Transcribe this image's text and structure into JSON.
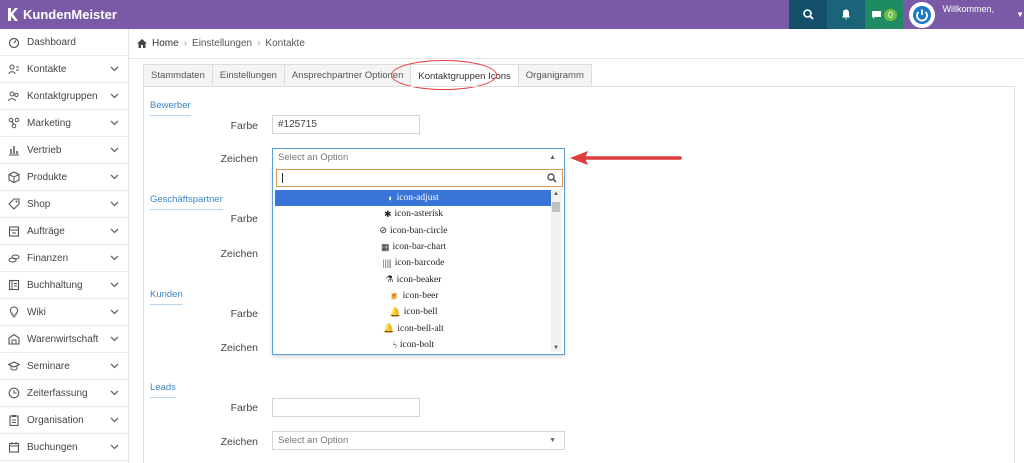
{
  "app": {
    "title": "KundenMeister"
  },
  "header": {
    "welcome": "Willkommen,",
    "badge_count": "0"
  },
  "sidebar": {
    "items": [
      {
        "label": "Dashboard",
        "icon": "dashboard-icon",
        "chev": false
      },
      {
        "label": "Kontakte",
        "icon": "contacts-icon",
        "chev": true
      },
      {
        "label": "Kontaktgruppen",
        "icon": "group-icon",
        "chev": true
      },
      {
        "label": "Marketing",
        "icon": "marketing-icon",
        "chev": true
      },
      {
        "label": "Vertrieb",
        "icon": "chart-icon",
        "chev": true
      },
      {
        "label": "Produkte",
        "icon": "box-icon",
        "chev": true
      },
      {
        "label": "Shop",
        "icon": "tag-icon",
        "chev": true
      },
      {
        "label": "Aufträge",
        "icon": "orders-icon",
        "chev": true
      },
      {
        "label": "Finanzen",
        "icon": "coins-icon",
        "chev": true
      },
      {
        "label": "Buchhaltung",
        "icon": "ledger-icon",
        "chev": true
      },
      {
        "label": "Wiki",
        "icon": "bulb-icon",
        "chev": true
      },
      {
        "label": "Warenwirtschaft",
        "icon": "warehouse-icon",
        "chev": true
      },
      {
        "label": "Seminare",
        "icon": "graduation-icon",
        "chev": true
      },
      {
        "label": "Zeiterfassung",
        "icon": "clock-icon",
        "chev": true
      },
      {
        "label": "Organisation",
        "icon": "clipboard-icon",
        "chev": true
      },
      {
        "label": "Buchungen",
        "icon": "calendar-icon",
        "chev": true
      }
    ]
  },
  "breadcrumb": {
    "home": "Home",
    "level1": "Einstellungen",
    "level2": "Kontakte"
  },
  "tabs": [
    {
      "label": "Stammdaten"
    },
    {
      "label": "Einstellungen"
    },
    {
      "label": "Ansprechpartner Optionen"
    },
    {
      "label": "Kontaktgruppen Icons"
    },
    {
      "label": "Organigramm"
    }
  ],
  "form": {
    "farbe_label": "Farbe",
    "zeichen_label": "Zeichen",
    "select_placeholder": "Select an Option",
    "sections": [
      {
        "title": "Bewerber",
        "farbe_value": "#125715"
      },
      {
        "title": "Geschäftspartner",
        "farbe_value": ""
      },
      {
        "title": "Kunden",
        "farbe_value": ""
      },
      {
        "title": "Leads",
        "farbe_value": ""
      }
    ]
  },
  "dropdown": {
    "search_value": "",
    "options": [
      {
        "label": "icon-adjust",
        "glyph": "◐"
      },
      {
        "label": "icon-asterisk",
        "glyph": "✱"
      },
      {
        "label": "icon-ban-circle",
        "glyph": "⊘"
      },
      {
        "label": "icon-bar-chart",
        "glyph": "▦"
      },
      {
        "label": "icon-barcode",
        "glyph": "|||||"
      },
      {
        "label": "icon-beaker",
        "glyph": "⚗"
      },
      {
        "label": "icon-beer",
        "glyph": "🍺"
      },
      {
        "label": "icon-bell",
        "glyph": "🔔"
      },
      {
        "label": "icon-bell-alt",
        "glyph": "🔔"
      },
      {
        "label": "icon-bolt",
        "glyph": "ϟ"
      }
    ]
  },
  "colors": {
    "accent": "#7a5aa6",
    "topbar_dark": "#15506b",
    "highlight": "#3875d7",
    "annotation": "#e03c3c"
  }
}
